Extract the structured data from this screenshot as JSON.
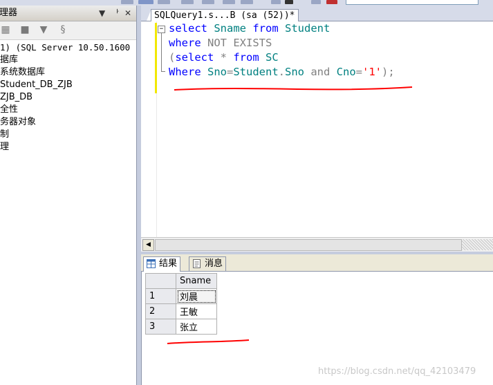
{
  "explorer": {
    "title": "理器",
    "controls": [
      "▼",
      "ᅡ",
      "✕"
    ],
    "tree": [
      "1) (SQL Server 10.50.1600",
      "据库",
      "系统数据库",
      "Student_DB_ZJB",
      "ZJB_DB",
      "全性",
      "务器对象",
      "制",
      "理"
    ]
  },
  "editor": {
    "tab_label": "SQLQuery1.s...B (sa (52))*",
    "fold_marker": "−",
    "code": [
      [
        {
          "t": "select ",
          "c": "kw"
        },
        {
          "t": "Sname ",
          "c": "ob"
        },
        {
          "t": "from ",
          "c": "kw"
        },
        {
          "t": "Student",
          "c": "ob"
        }
      ],
      [
        {
          "t": "where ",
          "c": "kw"
        },
        {
          "t": "NOT ",
          "c": "gr"
        },
        {
          "t": "EXISTS",
          "c": "gr"
        }
      ],
      [
        {
          "t": "(",
          "c": "gr"
        },
        {
          "t": "select ",
          "c": "kw"
        },
        {
          "t": "* ",
          "c": "gr"
        },
        {
          "t": "from ",
          "c": "kw"
        },
        {
          "t": "SC",
          "c": "ob"
        }
      ],
      [
        {
          "t": "Where ",
          "c": "kw"
        },
        {
          "t": "Sno",
          "c": "ob"
        },
        {
          "t": "=",
          "c": "gr"
        },
        {
          "t": "Student",
          "c": "ob"
        },
        {
          "t": ".",
          "c": "gr"
        },
        {
          "t": "Sno ",
          "c": "ob"
        },
        {
          "t": "and ",
          "c": "gr"
        },
        {
          "t": "Cno",
          "c": "ob"
        },
        {
          "t": "=",
          "c": "gr"
        },
        {
          "t": "'1'",
          "c": "st"
        },
        {
          "t": ");",
          "c": "gr"
        }
      ]
    ]
  },
  "results": {
    "tabs": [
      "结果",
      "消息"
    ],
    "column": "Sname",
    "rows": [
      {
        "num": "1",
        "sname": "刘晨"
      },
      {
        "num": "2",
        "sname": "王敏"
      },
      {
        "num": "3",
        "sname": "张立"
      }
    ]
  },
  "watermark": "https://blog.csdn.net/qq_42103479",
  "colors": {
    "keyword": "#0000ff",
    "object": "#008080",
    "operator": "#808080",
    "string": "#ff0000",
    "annotation": "#ff0000"
  }
}
